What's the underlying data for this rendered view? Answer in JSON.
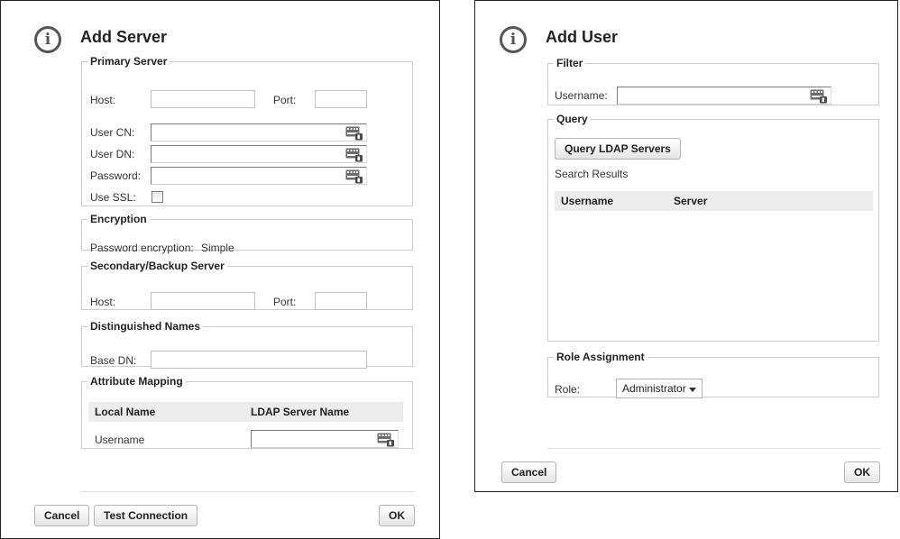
{
  "add_server": {
    "title": "Add Server",
    "primary": {
      "legend": "Primary Server",
      "host_label": "Host:",
      "host_value": "",
      "port_label": "Port:",
      "port_value": "",
      "user_cn_label": "User CN:",
      "user_dn_label": "User DN:",
      "password_label": "Password:",
      "use_ssl_label": "Use SSL:",
      "use_ssl_checked": false
    },
    "encryption": {
      "legend": "Encryption",
      "label": "Password encryption:",
      "value": "Simple"
    },
    "secondary": {
      "legend": "Secondary/Backup Server",
      "host_label": "Host:",
      "port_label": "Port:"
    },
    "names": {
      "legend": "Distinguished Names",
      "base_dn_label": "Base DN:"
    },
    "mapping": {
      "legend": "Attribute Mapping",
      "col_local": "Local Name",
      "col_ldap": "LDAP Server Name",
      "row_username": "Username"
    },
    "buttons": {
      "cancel": "Cancel",
      "test": "Test Connection",
      "ok": "OK"
    }
  },
  "add_user": {
    "title": "Add User",
    "filter": {
      "legend": "Filter",
      "username_label": "Username:"
    },
    "query": {
      "legend": "Query",
      "button": "Query LDAP Servers",
      "results_label": "Search Results",
      "col_username": "Username",
      "col_server": "Server"
    },
    "role": {
      "legend": "Role Assignment",
      "label": "Role:",
      "selected": "Administrator"
    },
    "buttons": {
      "cancel": "Cancel",
      "ok": "OK"
    }
  },
  "icons": {
    "info": "info-icon",
    "keyboard": "keyboard-icon",
    "dropdown": "chevron-down-icon"
  },
  "colors": {
    "header_bg": "#ececec",
    "border": "#cccccc"
  }
}
